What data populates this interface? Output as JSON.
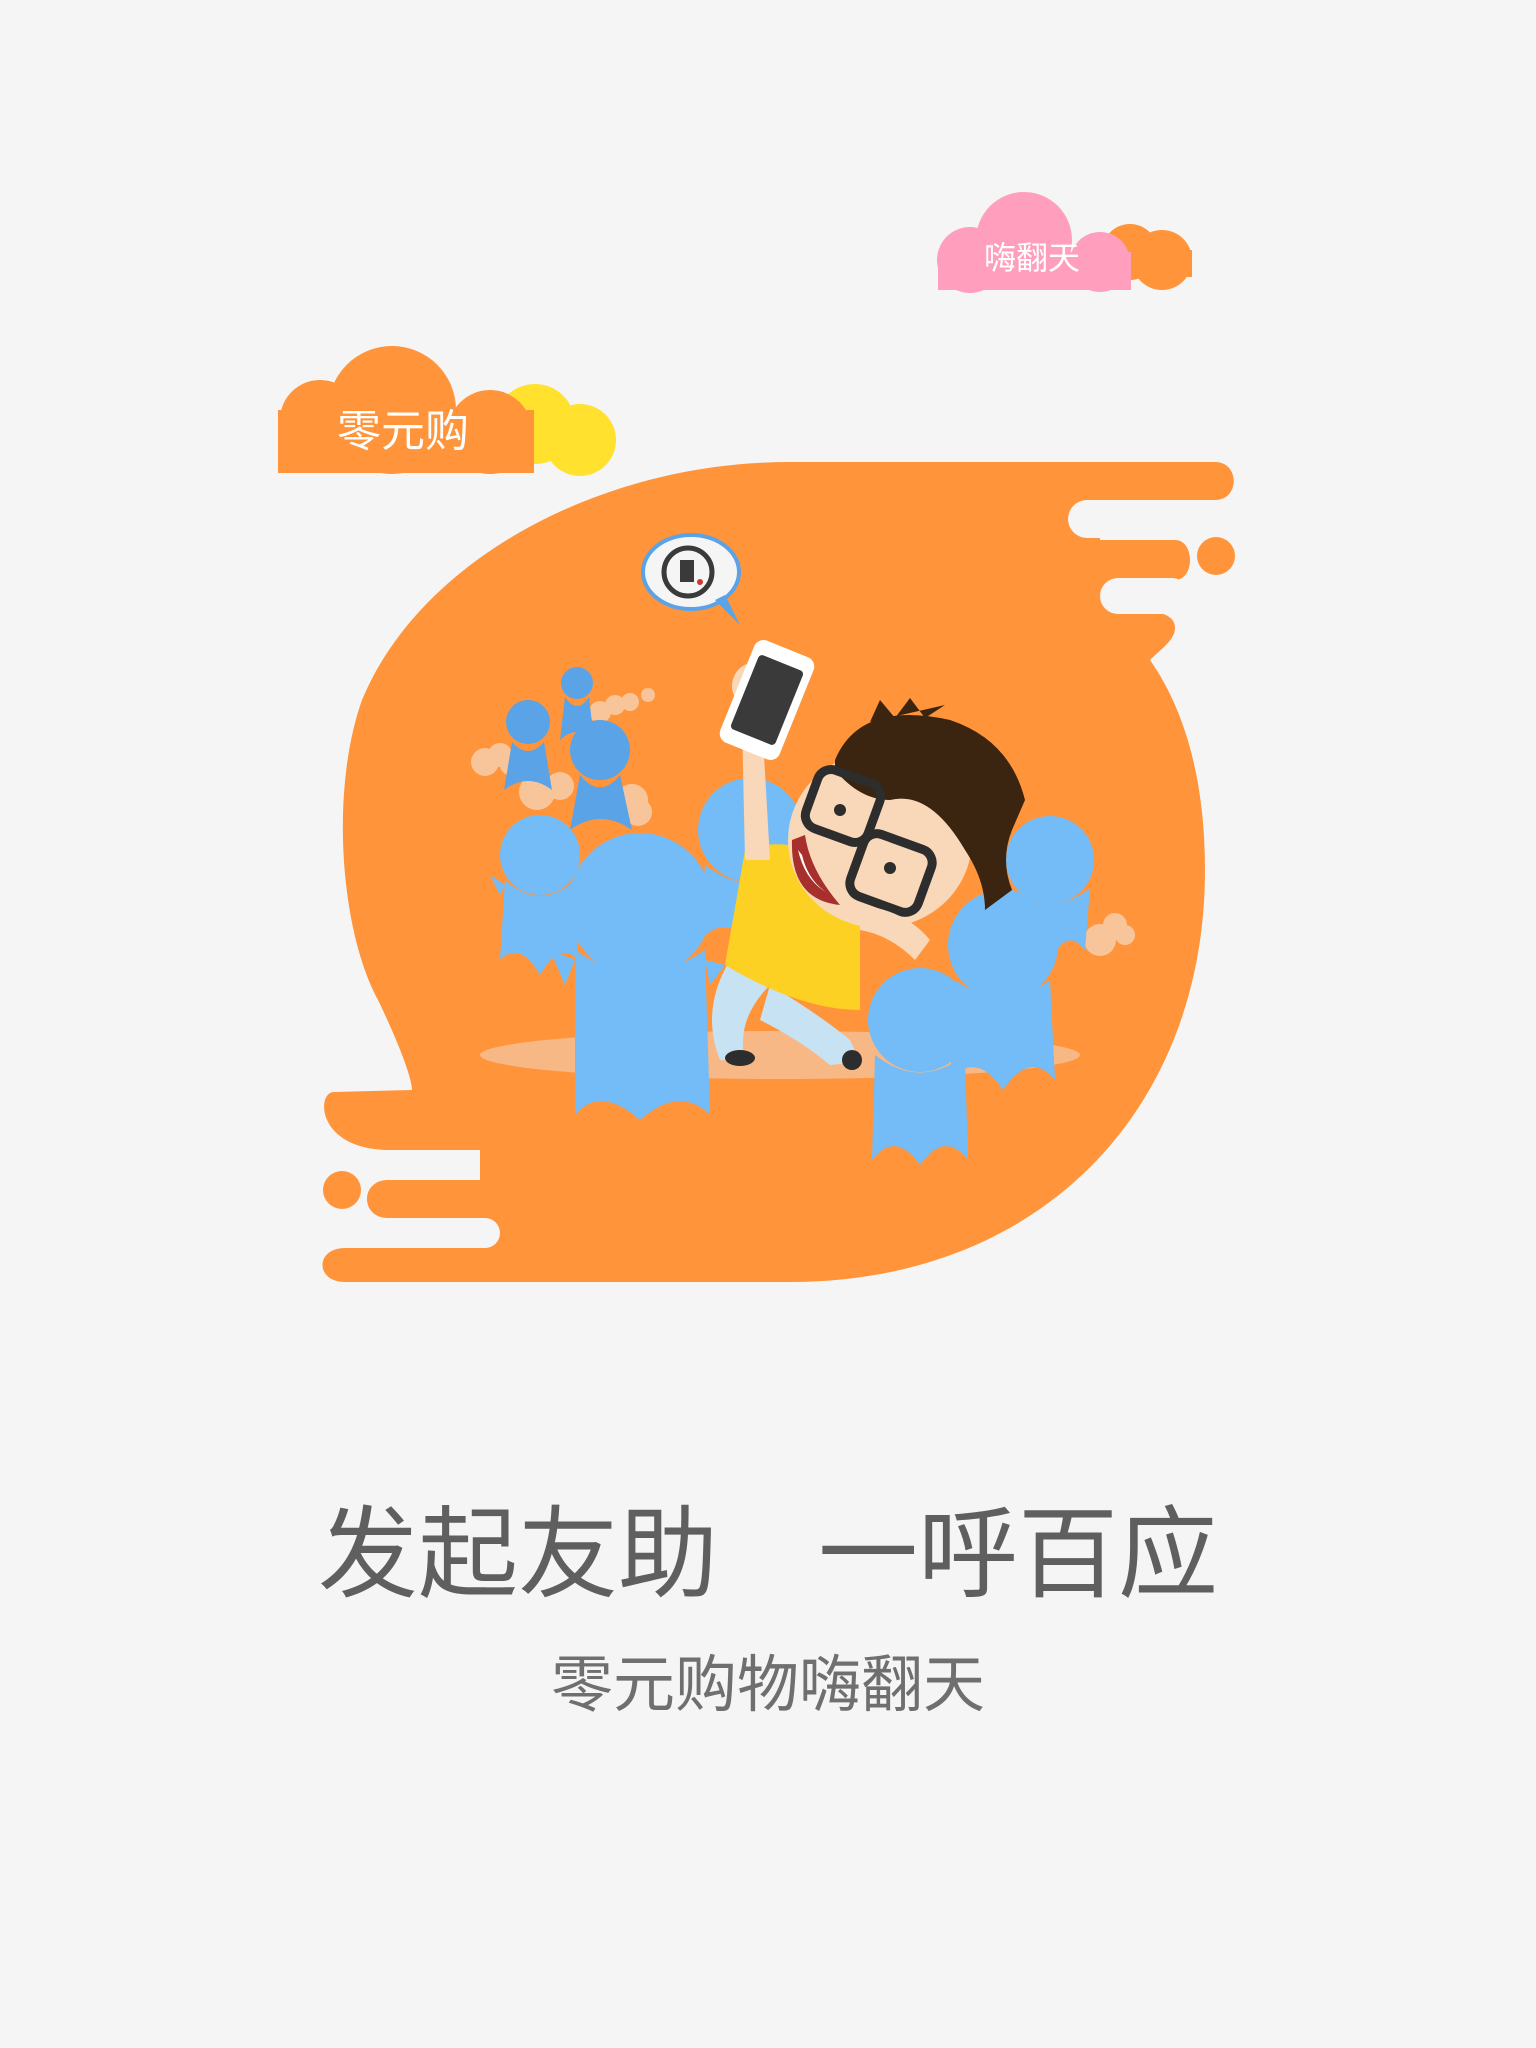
{
  "colors": {
    "background": "#f5f5f5",
    "orange": "#ff943b",
    "pink": "#ff9fbd",
    "yellow": "#ffe12e",
    "blue": "#6ebaf5",
    "text": "#5f5f5f"
  },
  "illustration": {
    "cloud_left_label": "零元购",
    "cloud_right_label": "嗨翻天",
    "icons": [
      "cloud-icon",
      "phone-icon",
      "logo-bubble-icon",
      "crowd-figure-icon",
      "cartoon-boy-icon"
    ]
  },
  "main": {
    "headline": "发起友助　一呼百应",
    "subline": "零元购物嗨翻天"
  }
}
